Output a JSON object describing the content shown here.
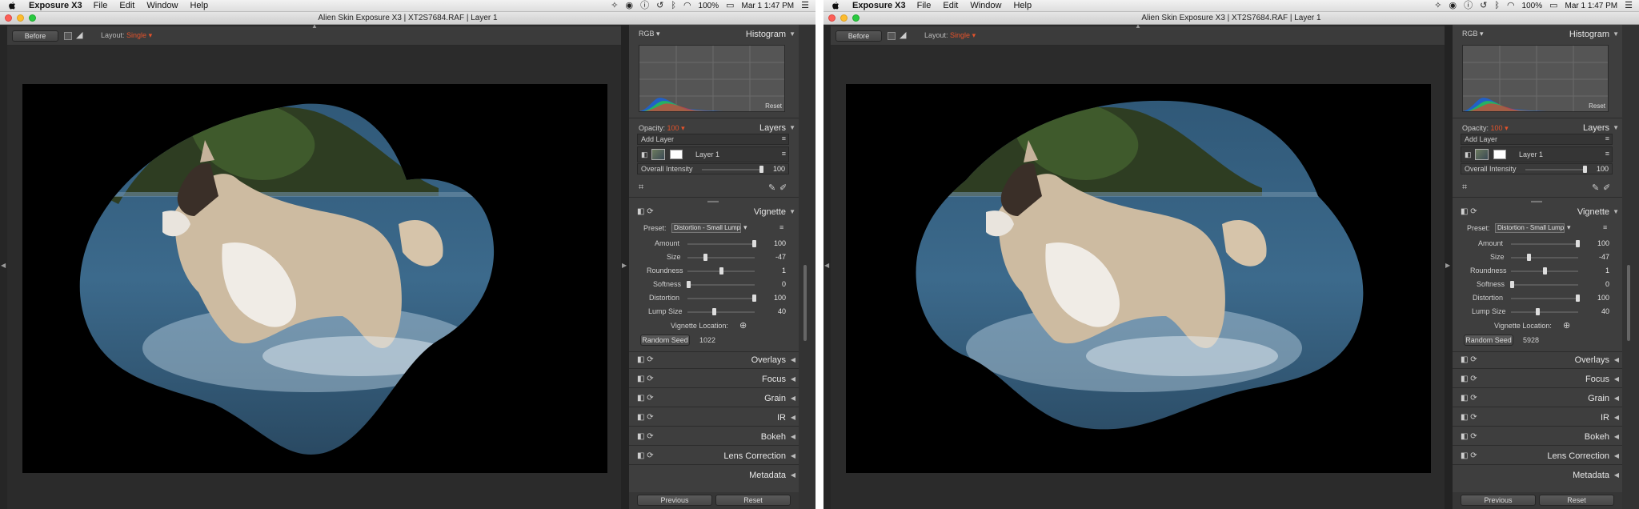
{
  "menubar": {
    "app_name": "Exposure X3",
    "menus": [
      "File",
      "Edit",
      "Window",
      "Help"
    ],
    "battery": "100%",
    "datetime": "Mar 1  1:47 PM"
  },
  "window": {
    "title": "Alien Skin Exposure X3 | XT2S7684.RAF | Layer 1"
  },
  "toolbar": {
    "before_label": "Before",
    "layout_label": "Layout:",
    "layout_value": "Single"
  },
  "panel": {
    "channel": "RGB",
    "histogram_title": "Histogram",
    "histogram_reset": "Reset",
    "opacity_label": "Opacity:",
    "opacity_value": "100",
    "layers_title": "Layers",
    "add_layer_label": "Add Layer",
    "layer_name": "Layer 1",
    "intensity_label": "Overall Intensity",
    "intensity_value": "100",
    "intensity_level": 1.0,
    "vignette_title": "Vignette",
    "preset_label": "Preset:",
    "preset_value": "Distortion - Small Lumps*",
    "sliders": [
      {
        "label": "Amount",
        "value": "100",
        "level": 1.0
      },
      {
        "label": "Size",
        "value": "-47",
        "level": 0.27
      },
      {
        "label": "Roundness",
        "value": "1",
        "level": 0.51
      },
      {
        "label": "Softness",
        "value": "0",
        "level": 0.02
      },
      {
        "label": "Distortion",
        "value": "100",
        "level": 1.0
      },
      {
        "label": "Lump Size",
        "value": "40",
        "level": 0.4
      }
    ],
    "vignette_location_label": "Vignette Location:",
    "random_seed_label": "Random Seed",
    "sections": [
      "Overlays",
      "Focus",
      "Grain",
      "IR",
      "Bokeh",
      "Lens Correction",
      "Metadata"
    ],
    "previous_label": "Previous",
    "reset_label": "Reset"
  },
  "screens": [
    {
      "seed_value": "1022"
    },
    {
      "seed_value": "5928"
    }
  ]
}
